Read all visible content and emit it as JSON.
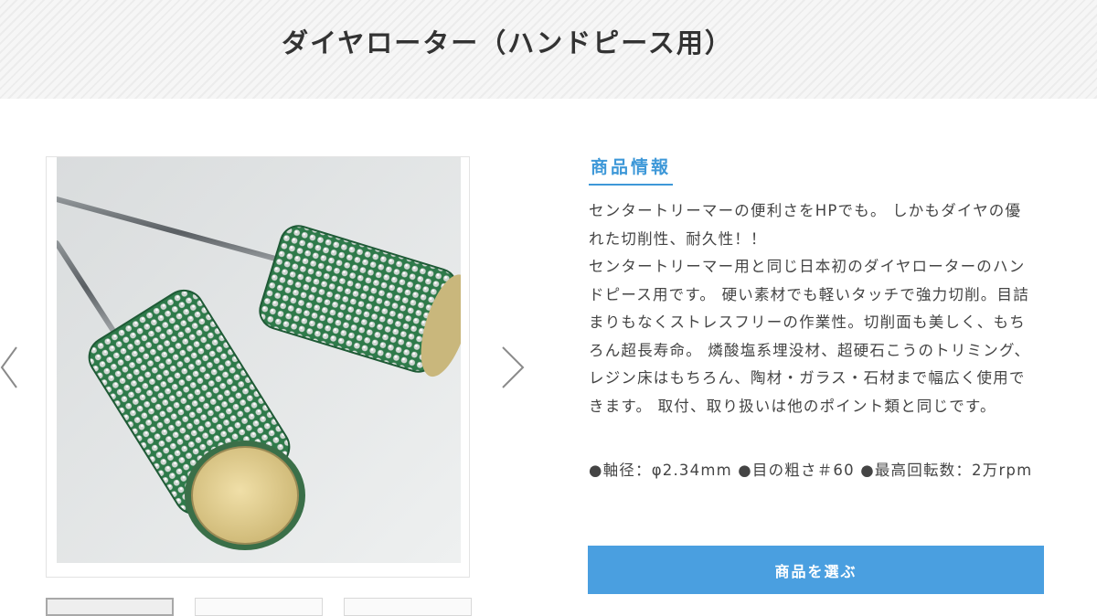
{
  "page": {
    "title": "ダイヤローター（ハンドピース用）"
  },
  "gallery": {
    "main_image": "product-photo",
    "prev_icon": "chevron-left-icon",
    "next_icon": "chevron-right-icon",
    "thumbnail_count": 3
  },
  "product_info": {
    "heading": "商品情報",
    "description": "センタートリーマーの便利さをHPでも。 しかもダイヤの優れた切削性、耐久性！！\nセンタートリーマー用と同じ日本初のダイヤローターのハンドピース用です。 硬い素材でも軽いタッチで強力切削。目詰まりもなくストレスフリーの作業性。切削面も美しく、もちろん超長寿命。 燐酸塩系埋没材、超硬石こうのトリミング、レジン床はもちろん、陶材・ガラス・石材まで幅広く使用できます。 取付、取り扱いは他のポイント類と同じです。",
    "specs": "●軸径：φ2.34mm ●目の粗さ＃60 ●最高回転数：2万rpm",
    "select_button_label": "商品を選ぶ"
  },
  "colors": {
    "accent": "#3e98d8",
    "button": "#4a9fe0",
    "burr_green": "#2f7a4c",
    "burr_tip": "#e6d49a"
  }
}
